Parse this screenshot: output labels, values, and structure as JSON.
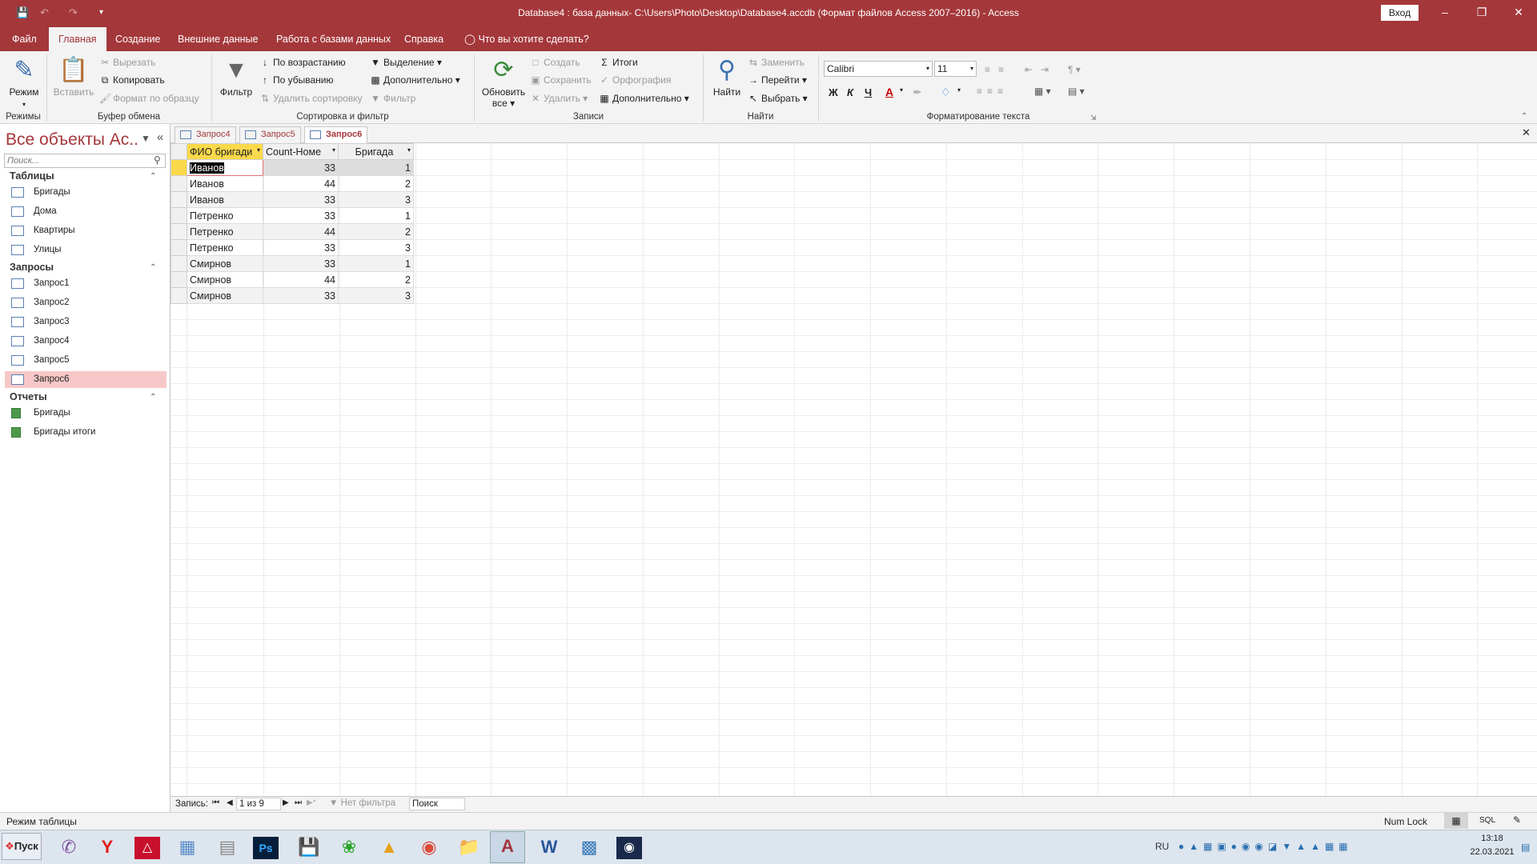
{
  "window": {
    "title": "Database4 : база данных- C:\\Users\\Photo\\Desktop\\Database4.accdb (Формат файлов Access 2007–2016)  -  Access",
    "signin": "Вход",
    "minimize": "–",
    "restore": "❐",
    "close": "✕"
  },
  "menu": {
    "tabs": [
      "Файл",
      "Главная",
      "Создание",
      "Внешние данные",
      "Работа с базами данных",
      "Справка"
    ],
    "tell_me": "Что вы хотите сделать?"
  },
  "ribbon": {
    "groups": {
      "views": "Режимы",
      "clipboard": "Буфер обмена",
      "sort_filter": "Сортировка и фильтр",
      "records": "Записи",
      "find": "Найти",
      "text_format": "Форматирование текста"
    },
    "view": "Режим",
    "paste": "Вставить",
    "cut": "Вырезать",
    "copy": "Копировать",
    "format_painter": "Формат по образцу",
    "filter": "Фильтр",
    "ascending": "По возрастанию",
    "descending": "По убыванию",
    "remove_sort": "Удалить сортировку",
    "selection": "Выделение",
    "advanced": "Дополнительно",
    "toggle_filter": "Фильтр",
    "refresh_all_1": "Обновить",
    "refresh_all_2": "все",
    "new": "Создать",
    "save": "Сохранить",
    "delete": "Удалить",
    "totals": "Итоги",
    "spelling": "Орфография",
    "more": "Дополнительно",
    "find": "Найти",
    "replace": "Заменить",
    "goto": "Перейти",
    "select": "Выбрать",
    "font": "Calibri",
    "size": "11",
    "bold": "Ж",
    "italic": "К",
    "underline": "Ч"
  },
  "nav": {
    "title": "Все объекты Ac...",
    "search_placeholder": "Поиск...",
    "sections": [
      {
        "label": "Таблицы",
        "items": [
          "Бригады",
          "Дома",
          "Квартиры",
          "Улицы"
        ]
      },
      {
        "label": "Запросы",
        "items": [
          "Запрос1",
          "Запрос2",
          "Запрос3",
          "Запрос4",
          "Запрос5",
          "Запрос6"
        ]
      },
      {
        "label": "Отчеты",
        "items": [
          "Бригады",
          "Бригады итоги"
        ]
      }
    ],
    "selected": "Запрос6"
  },
  "doc_tabs": [
    "Запрос4",
    "Запрос5",
    "Запрос6"
  ],
  "datasheet": {
    "columns": [
      "ФИО бригади",
      "Count-Номе",
      "Бригада"
    ],
    "rows": [
      [
        "Иванов",
        "33",
        "1"
      ],
      [
        "Иванов",
        "44",
        "2"
      ],
      [
        "Иванов",
        "33",
        "3"
      ],
      [
        "Петренко",
        "33",
        "1"
      ],
      [
        "Петренко",
        "44",
        "2"
      ],
      [
        "Петренко",
        "33",
        "3"
      ],
      [
        "Смирнов",
        "33",
        "1"
      ],
      [
        "Смирнов",
        "44",
        "2"
      ],
      [
        "Смирнов",
        "33",
        "3"
      ]
    ]
  },
  "record_nav": {
    "label": "Запись:",
    "position": "1 из 9",
    "no_filter": "Нет фильтра",
    "search": "Поиск"
  },
  "status": {
    "mode": "Режим таблицы",
    "numlock": "Num Lock",
    "sql": "SQL"
  },
  "taskbar": {
    "start": "Пуск",
    "lang": "RU",
    "time": "13:18",
    "date": "22.03.2021"
  }
}
